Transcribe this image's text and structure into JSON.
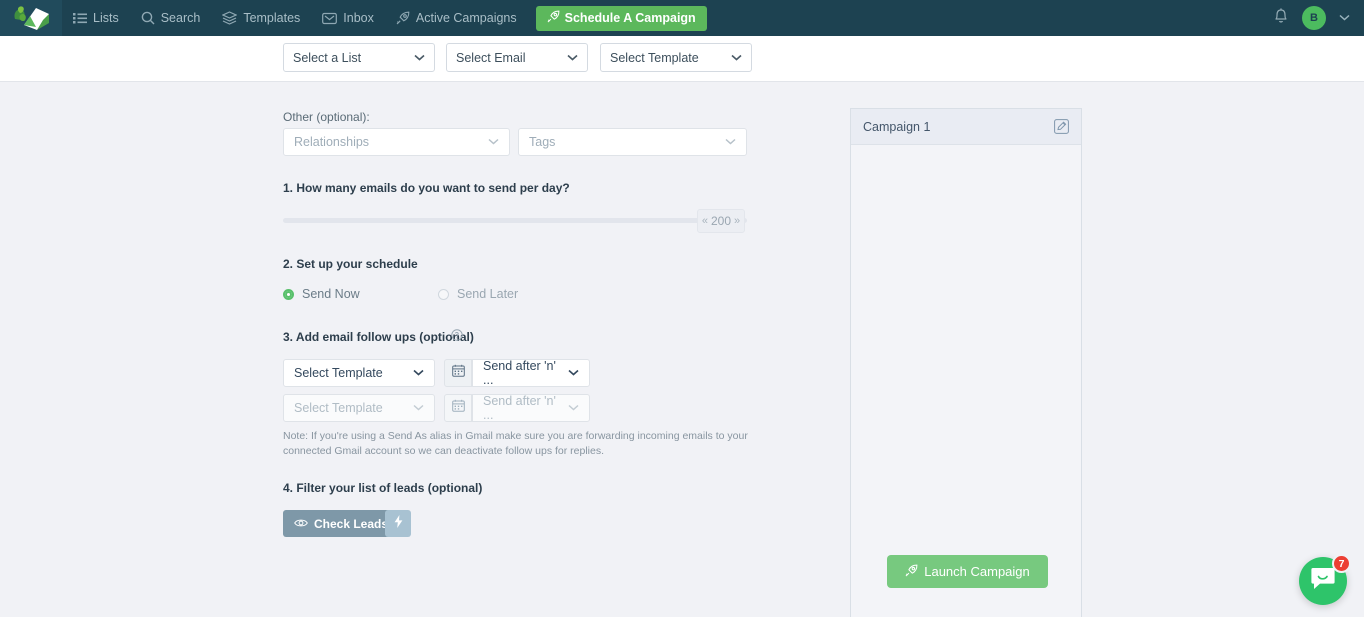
{
  "nav": {
    "logo": "envelope-leaf-logo",
    "items": [
      {
        "label": "Lists",
        "icon": "list-icon"
      },
      {
        "label": "Search",
        "icon": "search-icon"
      },
      {
        "label": "Templates",
        "icon": "layers-icon"
      },
      {
        "label": "Inbox",
        "icon": "inbox-icon"
      },
      {
        "label": "Active Campaigns",
        "icon": "rocket-icon"
      }
    ],
    "primary_button": {
      "label": "Schedule A Campaign",
      "icon": "rocket-icon",
      "color": "#5cb85c"
    },
    "bell_icon": "bell-icon",
    "avatar_initial": "B",
    "avatar_color": "#4cbb5f",
    "caret": "⌄"
  },
  "selector_bar": {
    "list_select": "Select a List",
    "email_select": "Select Email",
    "template_select": "Select Template"
  },
  "form": {
    "other_label": "Other (optional):",
    "relationships_placeholder": "Relationships",
    "tags_placeholder": "Tags",
    "q1_label": "1. How many emails do you want to send per day?",
    "emails_per_day": "200",
    "slider_left_arrow": "«",
    "slider_right_arrow": "»",
    "q2_label": "2. Set up your schedule",
    "send_now_label": "Send Now",
    "send_later_label": "Send Later",
    "q3_label": "3. Add email follow ups (optional)",
    "help_icon": "question-circle-icon",
    "followups": [
      {
        "template": "Select Template",
        "timing": "Send after 'n' ...",
        "enabled": true
      },
      {
        "template": "Select Template",
        "timing": "Send after 'n' ...",
        "enabled": false
      }
    ],
    "note": "Note: If you're using a Send As alias in Gmail make sure you are forwarding incoming emails to your connected Gmail account so we can deactivate follow ups for replies.",
    "q4_label": "4. Filter your list of leads (optional)",
    "check_leads_label": "Check Leads",
    "check_leads_icon": "eye-icon",
    "bolt_icon": "lightning-bolt-icon"
  },
  "panel": {
    "title": "Campaign 1",
    "edit_icon": "edit-square-icon",
    "launch_label": "Launch Campaign",
    "launch_icon": "rocket-icon",
    "launch_color": "#77c97f"
  },
  "chat": {
    "icon": "chat-bubble-smile-icon",
    "badge_count": "7",
    "color": "#2ec46a",
    "badge_color": "#ec3f34"
  }
}
